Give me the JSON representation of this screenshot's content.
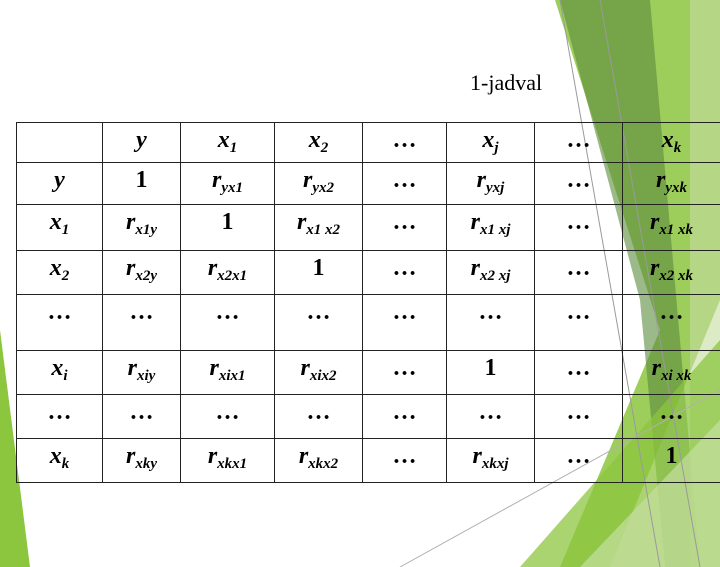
{
  "caption": "1-jadval",
  "colors": {
    "accent_green": "#8cc63f",
    "dark_green": "#5a8a3a",
    "light_green": "#c5dea0"
  },
  "table": {
    "header": [
      {
        "base": "",
        "sub": ""
      },
      {
        "base": "y",
        "sub": ""
      },
      {
        "base": "x",
        "sub": "1"
      },
      {
        "base": "x",
        "sub": "2"
      },
      {
        "base": "…",
        "sub": ""
      },
      {
        "base": "x",
        "sub": "j"
      },
      {
        "base": "…",
        "sub": ""
      },
      {
        "base": "x",
        "sub": "k"
      }
    ],
    "rows": [
      [
        {
          "base": "y",
          "sub": ""
        },
        {
          "base": "1",
          "sub": ""
        },
        {
          "base": "r",
          "sub": "yx1"
        },
        {
          "base": "r",
          "sub": "yx2"
        },
        {
          "base": "…",
          "sub": ""
        },
        {
          "base": "r",
          "sub": "yxj"
        },
        {
          "base": "…",
          "sub": ""
        },
        {
          "base": "r",
          "sub": "yxk"
        }
      ],
      [
        {
          "base": "x",
          "sub": "1"
        },
        {
          "base": "r",
          "sub": "x1y"
        },
        {
          "base": "1",
          "sub": ""
        },
        {
          "base": "r",
          "sub": "x1 x2"
        },
        {
          "base": "…",
          "sub": ""
        },
        {
          "base": "r",
          "sub": "x1 xj"
        },
        {
          "base": "…",
          "sub": ""
        },
        {
          "base": "r",
          "sub": "x1 xk"
        }
      ],
      [
        {
          "base": "x",
          "sub": "2"
        },
        {
          "base": "r",
          "sub": "x2y"
        },
        {
          "base": "r",
          "sub": "x2x1"
        },
        {
          "base": "1",
          "sub": ""
        },
        {
          "base": "…",
          "sub": ""
        },
        {
          "base": "r",
          "sub": "x2 xj"
        },
        {
          "base": "…",
          "sub": ""
        },
        {
          "base": "r",
          "sub": "x2 xk"
        }
      ],
      [
        {
          "base": "…",
          "sub": ""
        },
        {
          "base": "…",
          "sub": ""
        },
        {
          "base": "…",
          "sub": ""
        },
        {
          "base": "…",
          "sub": ""
        },
        {
          "base": "…",
          "sub": ""
        },
        {
          "base": "…",
          "sub": ""
        },
        {
          "base": "…",
          "sub": ""
        },
        {
          "base": "…",
          "sub": ""
        }
      ],
      [
        {
          "base": "x",
          "sub": "i"
        },
        {
          "base": "r",
          "sub": "xiy"
        },
        {
          "base": "r",
          "sub": "xix1"
        },
        {
          "base": "r",
          "sub": "xix2"
        },
        {
          "base": "…",
          "sub": ""
        },
        {
          "base": "1",
          "sub": ""
        },
        {
          "base": "…",
          "sub": ""
        },
        {
          "base": "r",
          "sub": "xi xk"
        }
      ],
      [
        {
          "base": "…",
          "sub": ""
        },
        {
          "base": "…",
          "sub": ""
        },
        {
          "base": "…",
          "sub": ""
        },
        {
          "base": "…",
          "sub": ""
        },
        {
          "base": "…",
          "sub": ""
        },
        {
          "base": "…",
          "sub": ""
        },
        {
          "base": "…",
          "sub": ""
        },
        {
          "base": "…",
          "sub": ""
        }
      ],
      [
        {
          "base": "x",
          "sub": "k"
        },
        {
          "base": "r",
          "sub": "xky"
        },
        {
          "base": "r",
          "sub": "xkx1"
        },
        {
          "base": "r",
          "sub": "xkx2"
        },
        {
          "base": "…",
          "sub": ""
        },
        {
          "base": "r",
          "sub": "xkxj"
        },
        {
          "base": "…",
          "sub": ""
        },
        {
          "base": "1",
          "sub": ""
        }
      ]
    ]
  }
}
